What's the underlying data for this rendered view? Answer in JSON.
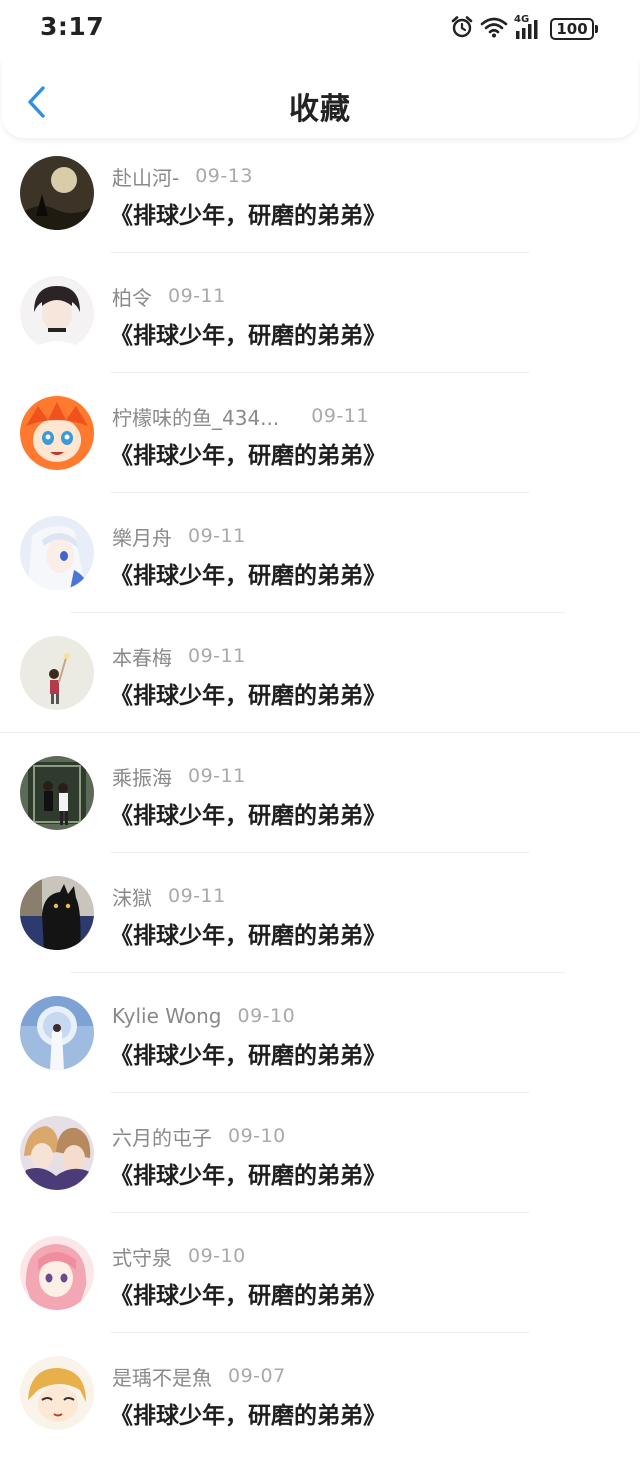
{
  "status_bar": {
    "time": "3:17",
    "network_label": "4G",
    "battery": "100"
  },
  "header": {
    "title": "收藏"
  },
  "favorites": [
    {
      "user": "赴山河-",
      "date": "09-13",
      "title": "《排球少年，研磨的弟弟》"
    },
    {
      "user": "柏令",
      "date": "09-11",
      "title": "《排球少年，研磨的弟弟》"
    },
    {
      "user": "柠檬味的鱼_434...",
      "date": "09-11",
      "title": "《排球少年，研磨的弟弟》"
    },
    {
      "user": "樂月舟",
      "date": "09-11",
      "title": "《排球少年，研磨的弟弟》"
    },
    {
      "user": "本春梅",
      "date": "09-11",
      "title": "《排球少年，研磨的弟弟》"
    },
    {
      "user": "乘振海",
      "date": "09-11",
      "title": "《排球少年，研磨的弟弟》"
    },
    {
      "user": "沫獄",
      "date": "09-11",
      "title": "《排球少年，研磨的弟弟》"
    },
    {
      "user": "Kylie Wong",
      "date": "09-10",
      "title": "《排球少年，研磨的弟弟》"
    },
    {
      "user": "六月的屯子",
      "date": "09-10",
      "title": "《排球少年，研磨的弟弟》"
    },
    {
      "user": "式守泉",
      "date": "09-10",
      "title": "《排球少年，研磨的弟弟》"
    },
    {
      "user": "是瑀不是魚",
      "date": "09-07",
      "title": "《排球少年，研磨的弟弟》"
    }
  ],
  "colors": {
    "accent": "#2f8fe0",
    "username": "#8a8a8a",
    "date": "#a9a9a9",
    "title": "#1f1f1f"
  }
}
